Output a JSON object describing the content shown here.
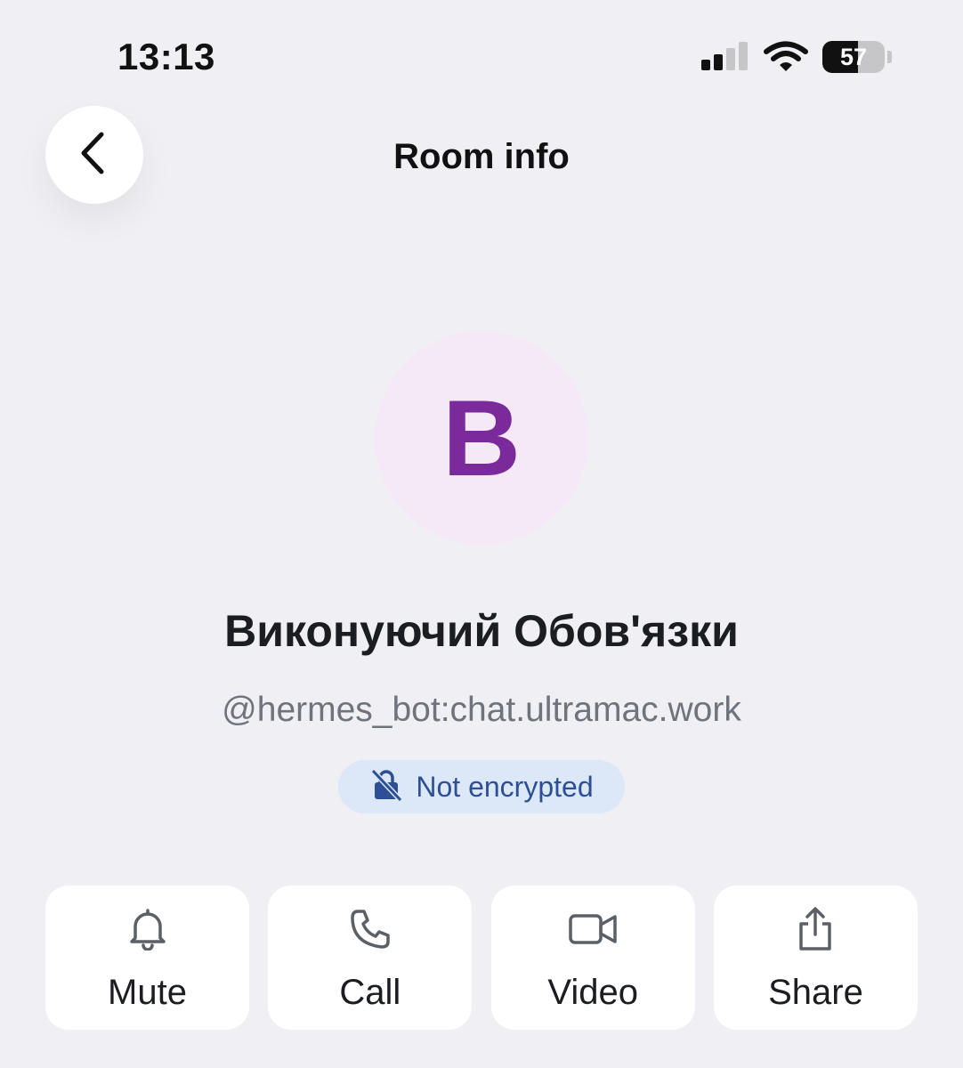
{
  "status_bar": {
    "time": "13:13",
    "battery_percent": "57",
    "battery_level": 0.57,
    "icons": [
      "signal-icon",
      "wifi-icon",
      "battery-icon"
    ]
  },
  "header": {
    "title": "Room info",
    "back_icon": "chevron-left-icon"
  },
  "room": {
    "avatar_letter": "B",
    "avatar_color": "#7a2a9a",
    "avatar_background": "#f6e9f7",
    "name": "Виконуючий Обов'язки",
    "id": "@hermes_bot:chat.ultramac.work"
  },
  "encryption": {
    "label": "Not encrypted",
    "icon": "lock-off-icon",
    "color": "#2d4f94"
  },
  "actions": [
    {
      "label": "Mute",
      "icon": "bell-icon"
    },
    {
      "label": "Call",
      "icon": "phone-icon"
    },
    {
      "label": "Video",
      "icon": "video-camera-icon"
    },
    {
      "label": "Share",
      "icon": "share-icon"
    }
  ]
}
